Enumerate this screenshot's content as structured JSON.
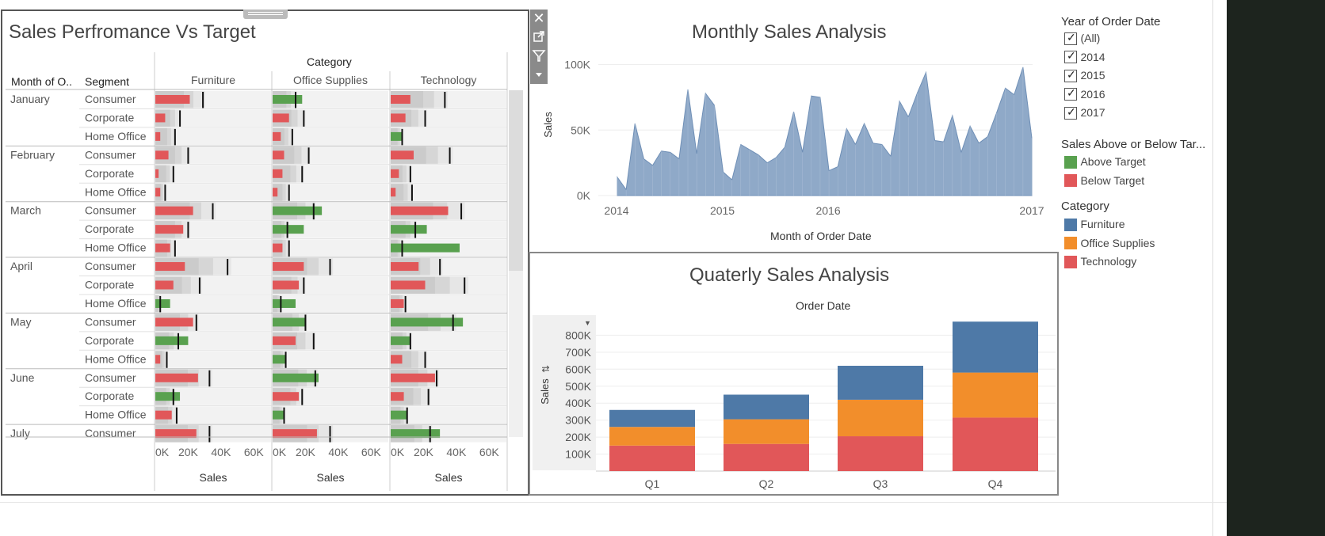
{
  "bullet": {
    "title": "Sales Perfromance Vs Target",
    "category_header": "Category",
    "row_headers": [
      "Month of O..",
      "Segment"
    ],
    "categories": [
      "Furniture",
      "Office Supplies",
      "Technology"
    ],
    "x_ticks": [
      "0K",
      "20K",
      "40K",
      "60K"
    ],
    "x_label": "Sales",
    "months": [
      "January",
      "February",
      "March",
      "April",
      "May",
      "June",
      "July"
    ],
    "segments": [
      "Consumer",
      "Corporate",
      "Home Office"
    ],
    "colors": {
      "above": "#59a14f",
      "below": "#e15759"
    }
  },
  "monthly": {
    "title": "Monthly Sales Analysis",
    "ylabel": "Sales",
    "xlabel": "Month of Order Date",
    "y_ticks": [
      "0K",
      "50K",
      "100K"
    ],
    "x_ticks": [
      "2014",
      "2015",
      "2016",
      "2017"
    ],
    "color": "#8fa9c8"
  },
  "quarterly": {
    "title": "Quaterly Sales Analysis",
    "top_label": "Order Date",
    "ylabel": "Sales",
    "y_ticks": [
      "100K",
      "200K",
      "300K",
      "400K",
      "500K",
      "600K",
      "700K",
      "800K"
    ],
    "colors": {
      "Furniture": "#4e79a7",
      "Office Supplies": "#f28e2b",
      "Technology": "#e15759"
    }
  },
  "legend": {
    "year_title": "Year of Order Date",
    "years": [
      "(All)",
      "2014",
      "2015",
      "2016",
      "2017"
    ],
    "target_title": "Sales Above or Below Tar...",
    "target_items": [
      {
        "label": "Above Target",
        "color": "#59a14f"
      },
      {
        "label": "Below Target",
        "color": "#e15759"
      }
    ],
    "category_title": "Category",
    "category_items": [
      {
        "label": "Furniture",
        "color": "#4e79a7"
      },
      {
        "label": "Office Supplies",
        "color": "#f28e2b"
      },
      {
        "label": "Technology",
        "color": "#e15759"
      }
    ]
  },
  "chart_data": [
    {
      "type": "bar",
      "title": "Sales Perfromance Vs Target",
      "xlabel": "Sales",
      "xlim": [
        0,
        70000
      ],
      "categories": [
        "Furniture",
        "Office Supplies",
        "Technology"
      ],
      "rows": [
        {
          "month": "January",
          "segment": "Consumer",
          "sales": [
            21000,
            18000,
            12000
          ],
          "target": [
            29000,
            14000,
            33000
          ]
        },
        {
          "month": "January",
          "segment": "Corporate",
          "sales": [
            6000,
            10000,
            9000
          ],
          "target": [
            15000,
            19000,
            21000
          ]
        },
        {
          "month": "January",
          "segment": "Home Office",
          "sales": [
            3000,
            5000,
            7000
          ],
          "target": [
            12000,
            12000,
            7000
          ]
        },
        {
          "month": "February",
          "segment": "Consumer",
          "sales": [
            8000,
            7000,
            14000
          ],
          "target": [
            20000,
            22000,
            36000
          ]
        },
        {
          "month": "February",
          "segment": "Corporate",
          "sales": [
            2000,
            6000,
            5000
          ],
          "target": [
            11000,
            18000,
            12000
          ]
        },
        {
          "month": "February",
          "segment": "Home Office",
          "sales": [
            3000,
            3000,
            3000
          ],
          "target": [
            6000,
            10000,
            13000
          ]
        },
        {
          "month": "March",
          "segment": "Consumer",
          "sales": [
            23000,
            30000,
            35000
          ],
          "target": [
            35000,
            25000,
            43000
          ]
        },
        {
          "month": "March",
          "segment": "Corporate",
          "sales": [
            17000,
            19000,
            22000
          ],
          "target": [
            20000,
            9000,
            15000
          ]
        },
        {
          "month": "March",
          "segment": "Home Office",
          "sales": [
            9000,
            6000,
            42000
          ],
          "target": [
            12000,
            10000,
            7000
          ]
        },
        {
          "month": "April",
          "segment": "Consumer",
          "sales": [
            18000,
            19000,
            17000
          ],
          "target": [
            44000,
            35000,
            30000
          ]
        },
        {
          "month": "April",
          "segment": "Corporate",
          "sales": [
            11000,
            16000,
            21000
          ],
          "target": [
            27000,
            19000,
            45000
          ]
        },
        {
          "month": "April",
          "segment": "Home Office",
          "sales": [
            9000,
            14000,
            8000
          ],
          "target": [
            3000,
            5000,
            9000
          ]
        },
        {
          "month": "May",
          "segment": "Consumer",
          "sales": [
            23000,
            20000,
            44000
          ],
          "target": [
            25000,
            20000,
            38000
          ]
        },
        {
          "month": "May",
          "segment": "Corporate",
          "sales": [
            20000,
            14000,
            12000
          ],
          "target": [
            14000,
            25000,
            12000
          ]
        },
        {
          "month": "May",
          "segment": "Home Office",
          "sales": [
            3000,
            8000,
            7000
          ],
          "target": [
            7000,
            8000,
            21000
          ]
        },
        {
          "month": "June",
          "segment": "Consumer",
          "sales": [
            26000,
            28000,
            27000
          ],
          "target": [
            33000,
            26000,
            28000
          ]
        },
        {
          "month": "June",
          "segment": "Corporate",
          "sales": [
            15000,
            16000,
            8000
          ],
          "target": [
            11000,
            18000,
            23000
          ]
        },
        {
          "month": "June",
          "segment": "Home Office",
          "sales": [
            10000,
            7000,
            10000
          ],
          "target": [
            13000,
            7000,
            10000
          ]
        },
        {
          "month": "July",
          "segment": "Consumer",
          "sales": [
            25000,
            27000,
            30000
          ],
          "target": [
            33000,
            35000,
            24000
          ]
        }
      ]
    },
    {
      "type": "area",
      "title": "Monthly Sales Analysis",
      "xlabel": "Month of Order Date",
      "ylabel": "Sales",
      "ylim": [
        0,
        110000
      ],
      "x": [
        "2014-01",
        "2014-02",
        "2014-03",
        "2014-04",
        "2014-05",
        "2014-06",
        "2014-07",
        "2014-08",
        "2014-09",
        "2014-10",
        "2014-11",
        "2014-12",
        "2015-01",
        "2015-02",
        "2015-03",
        "2015-04",
        "2015-05",
        "2015-06",
        "2015-07",
        "2015-08",
        "2015-09",
        "2015-10",
        "2015-11",
        "2015-12",
        "2016-01",
        "2016-02",
        "2016-03",
        "2016-04",
        "2016-05",
        "2016-06",
        "2016-07",
        "2016-08",
        "2016-09",
        "2016-10",
        "2016-11",
        "2016-12",
        "2017-01",
        "2017-02",
        "2017-03",
        "2017-04",
        "2017-05",
        "2017-06",
        "2017-07",
        "2017-08",
        "2017-09",
        "2017-10",
        "2017-11",
        "2017-12"
      ],
      "y": [
        14000,
        4500,
        55000,
        28000,
        23000,
        34000,
        33000,
        28000,
        81000,
        32000,
        78000,
        69000,
        18000,
        12000,
        39000,
        35000,
        31000,
        25000,
        29000,
        37000,
        64000,
        33000,
        76000,
        75000,
        19000,
        22000,
        51000,
        39000,
        55000,
        40000,
        39000,
        30000,
        72000,
        60000,
        78000,
        94000,
        42000,
        41000,
        61000,
        33000,
        53000,
        40000,
        45000,
        63000,
        82000,
        77000,
        98000,
        44000
      ]
    },
    {
      "type": "bar",
      "title": "Quaterly Sales Analysis",
      "xlabel": "Order Date",
      "ylabel": "Sales",
      "ylim": [
        0,
        900000
      ],
      "categories": [
        "Q1",
        "Q2",
        "Q3",
        "Q4"
      ],
      "series": [
        {
          "name": "Technology",
          "values": [
            150000,
            160000,
            205000,
            315000
          ]
        },
        {
          "name": "Office Supplies",
          "values": [
            110000,
            145000,
            215000,
            265000
          ]
        },
        {
          "name": "Furniture",
          "values": [
            100000,
            145000,
            200000,
            300000
          ]
        }
      ]
    }
  ]
}
